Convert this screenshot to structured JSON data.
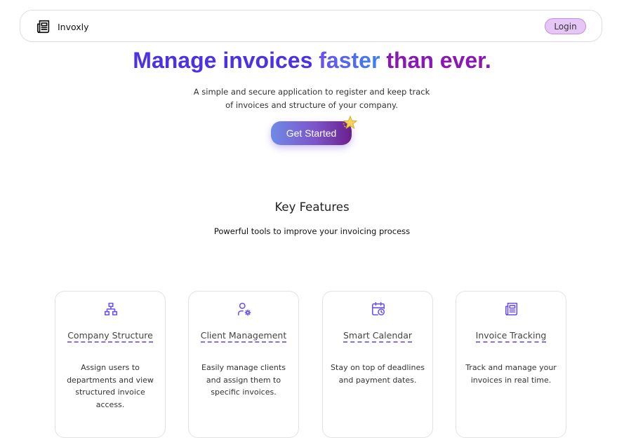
{
  "nav": {
    "brand": "Invoxly",
    "brand_icon": "newspaper-icon",
    "login_label": "Login"
  },
  "hero": {
    "title_part1": "Manage invoices ",
    "title_part2": "faster",
    "title_part3": " than ever.",
    "subtitle": "A simple and secure application to register and keep track of invoices and structure of your company.",
    "cta_label": "Get Started",
    "cta_decoration": "star-icon"
  },
  "features": {
    "title": "Key Features",
    "subtitle": "Powerful tools to improve your invoicing process",
    "items": [
      {
        "icon": "sitemap-icon",
        "title": "Company Structure",
        "description": "Assign users to departments and view structured invoice access."
      },
      {
        "icon": "user-gear-icon",
        "title": "Client Management",
        "description": "Easily manage clients and assign them to specific invoices."
      },
      {
        "icon": "calendar-clock-icon",
        "title": "Smart Calendar",
        "description": "Stay on top of deadlines and payment dates."
      },
      {
        "icon": "newspaper-icon",
        "title": "Invoice Tracking",
        "description": "Track and manage your invoices in real time."
      }
    ]
  },
  "colors": {
    "accent": "#6b4ff0",
    "login_bg": "#e6c6f6",
    "title_blue": "#4b32e6",
    "title_purple": "#8a18b5"
  }
}
